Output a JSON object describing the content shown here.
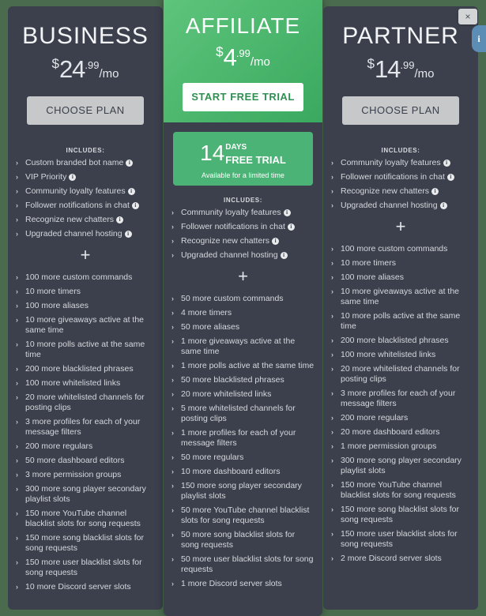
{
  "background_color": "#4a6b4d",
  "controls": {
    "close_label": "×",
    "info_label": "i"
  },
  "common": {
    "includes_label": "INCLUDES:",
    "plus_label": "+",
    "chevron": "›",
    "info_icon_label": "i"
  },
  "plans": [
    {
      "id": "business",
      "name": "BUSINESS",
      "price": {
        "currency": "$",
        "amount": "24",
        "cents": ".99",
        "period": "/mo"
      },
      "cta": "CHOOSE PLAN",
      "includes": [
        "Custom branded bot name",
        "VIP Priority",
        "Community loyalty features",
        "Follower notifications in chat",
        "Recognize new chatters",
        "Upgraded channel hosting"
      ],
      "extras": [
        "100 more custom commands",
        "10 more timers",
        "100 more aliases",
        "10 more giveaways active at the same time",
        "10 more polls active at the same time",
        "200 more blacklisted phrases",
        "100 more whitelisted links",
        "20 more whitelisted channels for posting clips",
        "3 more profiles for each of your message filters",
        "200 more regulars",
        "50 more dashboard editors",
        "3 more permission groups",
        "300 more song player secondary playlist slots",
        "150 more YouTube channel blacklist slots for song requests",
        "150 more song blacklist slots for song requests",
        "150 more user blacklist slots for song requests",
        "10 more Discord server slots"
      ]
    },
    {
      "id": "affiliate",
      "name": "AFFILIATE",
      "price": {
        "currency": "$",
        "amount": "4",
        "cents": ".99",
        "period": "/mo"
      },
      "cta": "START FREE TRIAL",
      "trial": {
        "number": "14",
        "days_label": "DAYS",
        "free_trial_label": "FREE TRIAL",
        "subtitle": "Available for a limited time"
      },
      "includes": [
        "Community loyalty features",
        "Follower notifications in chat",
        "Recognize new chatters",
        "Upgraded channel hosting"
      ],
      "extras": [
        "50 more custom commands",
        "4 more timers",
        "50 more aliases",
        "1 more giveaways active at the same time",
        "1 more polls active at the same time",
        "50 more blacklisted phrases",
        "20 more whitelisted links",
        "5 more whitelisted channels for posting clips",
        "1 more profiles for each of your message filters",
        "50 more regulars",
        "10 more dashboard editors",
        "150 more song player secondary playlist slots",
        "50 more YouTube channel blacklist slots for song requests",
        "50 more song blacklist slots for song requests",
        "50 more user blacklist slots for song requests",
        "1 more Discord server slots"
      ]
    },
    {
      "id": "partner",
      "name": "PARTNER",
      "price": {
        "currency": "$",
        "amount": "14",
        "cents": ".99",
        "period": "/mo"
      },
      "cta": "CHOOSE PLAN",
      "includes": [
        "Community loyalty features",
        "Follower notifications in chat",
        "Recognize new chatters",
        "Upgraded channel hosting"
      ],
      "extras": [
        "100 more custom commands",
        "10 more timers",
        "100 more aliases",
        "10 more giveaways active at the same time",
        "10 more polls active at the same time",
        "200 more blacklisted phrases",
        "100 more whitelisted links",
        "20 more whitelisted channels for posting clips",
        "3 more profiles for each of your message filters",
        "200 more regulars",
        "20 more dashboard editors",
        "1 more permission groups",
        "300 more song player secondary playlist slots",
        "150 more YouTube channel blacklist slots for song requests",
        "150 more song blacklist slots for song requests",
        "150 more user blacklist slots for song requests",
        "2 more Discord server slots"
      ]
    }
  ]
}
